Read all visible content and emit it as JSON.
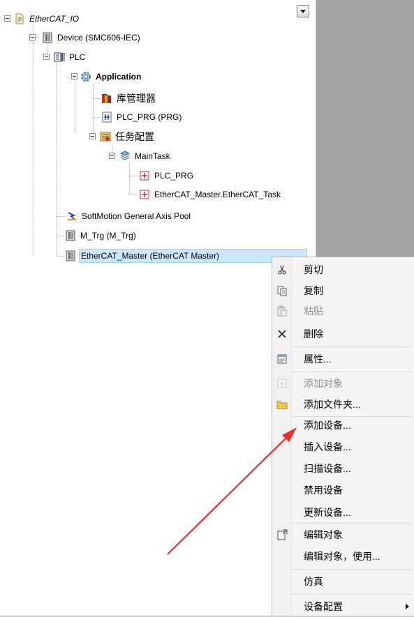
{
  "tree": {
    "nodes": [
      {
        "label": "EtherCAT_IO"
      },
      {
        "label": "Device (SMC606-IEC)"
      },
      {
        "label": "PLC"
      },
      {
        "label": "Application"
      },
      {
        "label": "库管理器"
      },
      {
        "label": "PLC_PRG (PRG)"
      },
      {
        "label": "任务配置"
      },
      {
        "label": "MainTask"
      },
      {
        "label": "PLC_PRG"
      },
      {
        "label": "EtherCAT_Master.EtherCAT_Task"
      },
      {
        "label": "SoftMotion General Axis Pool"
      },
      {
        "label": "M_Trg (M_Trg)"
      },
      {
        "label": "EtherCAT_Master (EtherCAT Master)"
      }
    ]
  },
  "context_menu": {
    "items": [
      {
        "label": "剪切",
        "icon": "scissors-icon",
        "enabled": true
      },
      {
        "label": "复制",
        "icon": "copy-icon",
        "enabled": true
      },
      {
        "label": "粘贴",
        "icon": "paste-icon",
        "enabled": false
      },
      {
        "label": "删除",
        "icon": "delete-x-icon",
        "enabled": true
      },
      {
        "label": "属性...",
        "icon": "properties-icon",
        "enabled": true
      },
      {
        "label": "添加对象",
        "icon": "add-object-icon",
        "enabled": false
      },
      {
        "label": "添加文件夹...",
        "icon": "folder-icon",
        "enabled": true
      },
      {
        "label": "添加设备...",
        "icon": "",
        "enabled": true
      },
      {
        "label": "插入设备...",
        "icon": "",
        "enabled": true
      },
      {
        "label": "扫描设备...",
        "icon": "",
        "enabled": true
      },
      {
        "label": "禁用设备",
        "icon": "",
        "enabled": true
      },
      {
        "label": "更新设备...",
        "icon": "",
        "enabled": true
      },
      {
        "label": "编辑对象",
        "icon": "edit-object-icon",
        "enabled": true
      },
      {
        "label": "编辑对象，使用...",
        "icon": "",
        "enabled": true
      },
      {
        "label": "仿真",
        "icon": "",
        "enabled": true
      },
      {
        "label": "设备配置",
        "icon": "",
        "enabled": true,
        "has_submenu": true
      }
    ]
  },
  "colors": {
    "selection_bg": "#cce8ff",
    "panel_gray": "#a3a3a3",
    "annotation_arrow": "#e8302a"
  }
}
